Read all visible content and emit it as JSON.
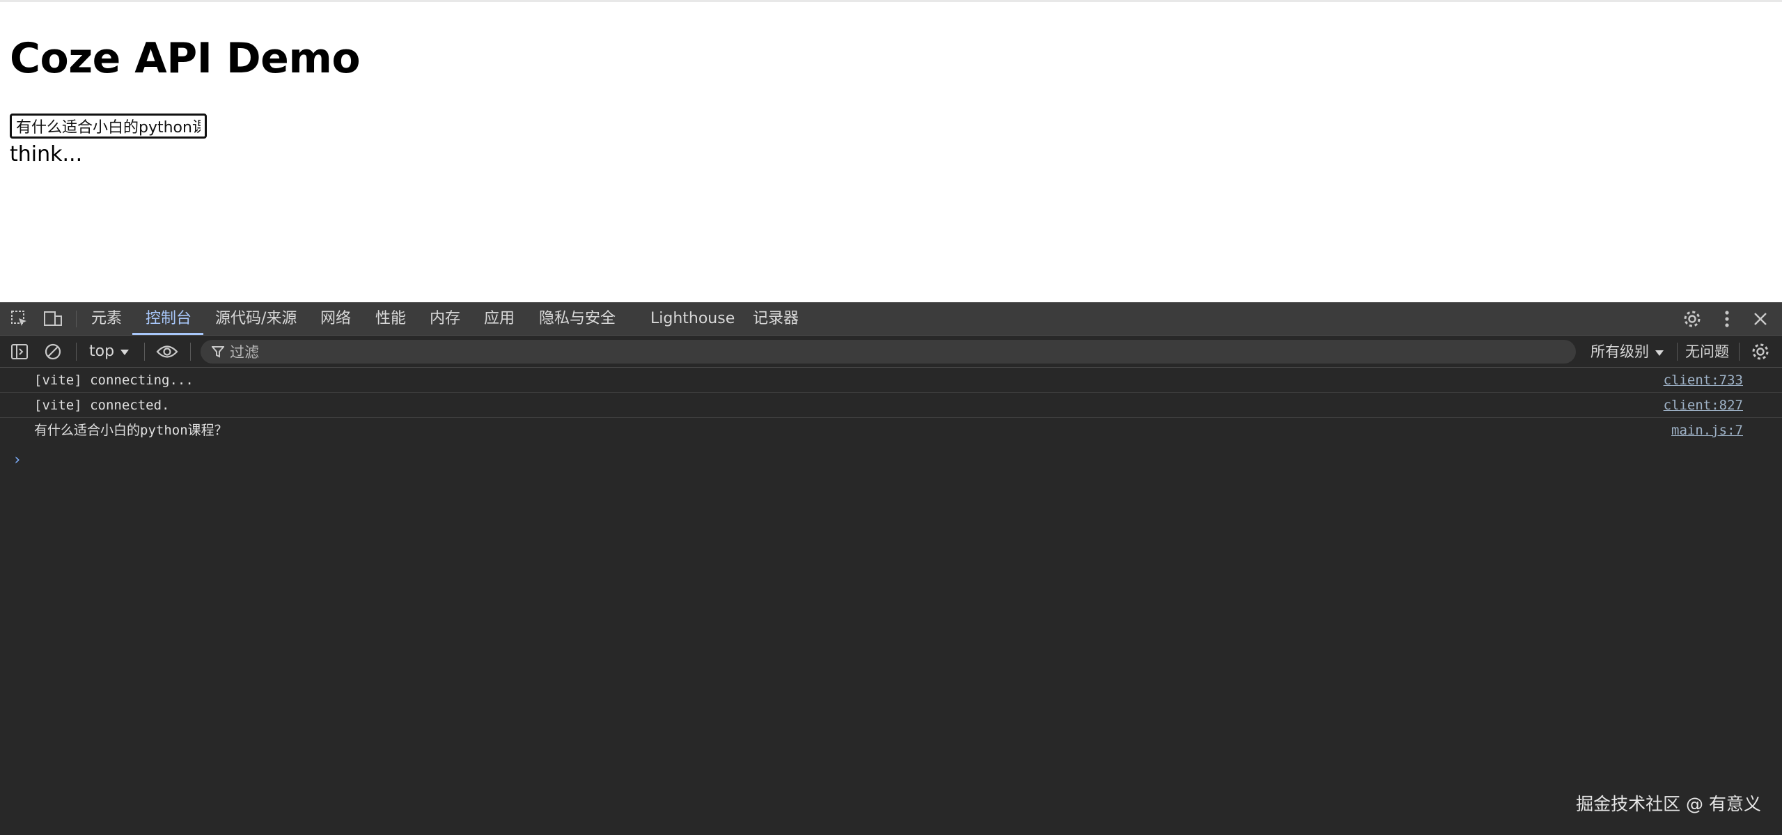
{
  "page": {
    "title": "Coze API Demo",
    "input_value": "有什么适合小白的python课程？",
    "status_text": "think..."
  },
  "devtools": {
    "tabs": [
      {
        "label": "元素",
        "active": false
      },
      {
        "label": "控制台",
        "active": true
      },
      {
        "label": "源代码/来源",
        "active": false
      },
      {
        "label": "网络",
        "active": false
      },
      {
        "label": "性能",
        "active": false
      },
      {
        "label": "内存",
        "active": false
      },
      {
        "label": "应用",
        "active": false
      },
      {
        "label": "隐私与安全",
        "active": false
      },
      {
        "label": "Lighthouse",
        "active": false
      },
      {
        "label": "记录器",
        "active": false
      }
    ],
    "toolbar": {
      "context": "top",
      "filter_label": "过滤",
      "levels": "所有级别",
      "issues": "无问题"
    },
    "logs": [
      {
        "message": "[vite] connecting...",
        "source": "client:733"
      },
      {
        "message": "[vite] connected.",
        "source": "client:827"
      },
      {
        "message": "有什么适合小白的python课程？",
        "source": "main.js:7"
      }
    ],
    "accent": "#a8c7fa"
  },
  "watermark": "掘金技术社区 @ 有意义"
}
